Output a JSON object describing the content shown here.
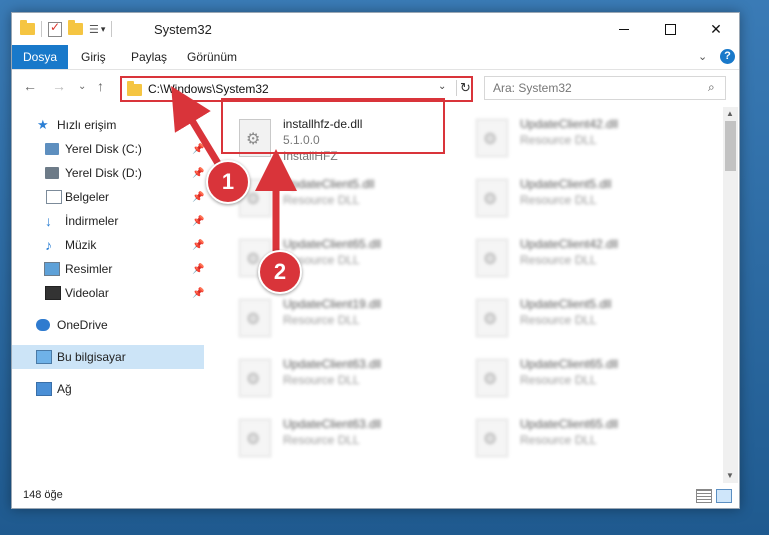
{
  "window": {
    "title": "System32"
  },
  "ribbon": {
    "tabs": [
      "Dosya",
      "Giriş",
      "Paylaş",
      "Görünüm"
    ],
    "help_label": "?",
    "expand_label": "⌄"
  },
  "nav": {
    "back": "←",
    "forward": "→",
    "recent": "⌄",
    "up": "↑"
  },
  "address": {
    "path": "C:\\Windows\\System32",
    "dropdown": "⌄",
    "refresh": "↻"
  },
  "search": {
    "placeholder": "Ara: System32",
    "icon": "⌕"
  },
  "sidebar": {
    "items": [
      {
        "label": "Hızlı erişim",
        "icon": "star-icon",
        "pinned": false
      },
      {
        "label": "Yerel Disk (C:)",
        "icon": "drive-icon",
        "pinned": true
      },
      {
        "label": "Yerel Disk (D:)",
        "icon": "drive-icon",
        "pinned": true
      },
      {
        "label": "Belgeler",
        "icon": "documents-icon",
        "pinned": true
      },
      {
        "label": "İndirmeler",
        "icon": "downloads-icon",
        "pinned": true
      },
      {
        "label": "Müzik",
        "icon": "music-icon",
        "pinned": true
      },
      {
        "label": "Resimler",
        "icon": "pictures-icon",
        "pinned": true
      },
      {
        "label": "Videolar",
        "icon": "videos-icon",
        "pinned": true
      },
      {
        "label": "OneDrive",
        "icon": "cloud-icon",
        "pinned": false
      },
      {
        "label": "Bu bilgisayar",
        "icon": "computer-icon",
        "pinned": false,
        "selected": true
      },
      {
        "label": "Ağ",
        "icon": "network-icon",
        "pinned": false
      }
    ],
    "pin_glyph": "📌"
  },
  "files": {
    "highlighted": {
      "name": "installhfz-de.dll",
      "version": "5.1.0.0",
      "product": "InstallHFZ"
    },
    "others": [
      {
        "name": "UpdateClient42.dll",
        "desc": "Resource DLL"
      },
      {
        "name": "UpdateClient5.dll",
        "desc": "Resource DLL"
      },
      {
        "name": "UpdateClient5.dll",
        "desc": "Resource DLL"
      },
      {
        "name": "UpdateClient65.dll",
        "desc": "Resource DLL"
      },
      {
        "name": "UpdateClient42.dll",
        "desc": "Resource DLL"
      },
      {
        "name": "UpdateClient19.dll",
        "desc": "Resource DLL"
      },
      {
        "name": "UpdateClient5.dll",
        "desc": "Resource DLL"
      },
      {
        "name": "UpdateClient63.dll",
        "desc": "Resource DLL"
      },
      {
        "name": "UpdateClient65.dll",
        "desc": "Resource DLL"
      },
      {
        "name": "UpdateClient63.dll",
        "desc": "Resource DLL"
      },
      {
        "name": "UpdateClient65.dll",
        "desc": "Resource DLL"
      }
    ]
  },
  "status": {
    "count": "148 öğe"
  },
  "annotations": {
    "badge1": "1",
    "badge2": "2",
    "color": "#d9343a"
  }
}
